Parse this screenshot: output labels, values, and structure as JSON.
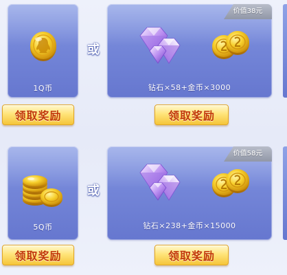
{
  "rewards": [
    {
      "qcoin_label": "1Q币",
      "or_text": "或",
      "value_badge": "价值38元",
      "bundle_label": "钻石×58+金币×3000",
      "button_left": "领取奖励",
      "button_right": "领取奖励",
      "icons": {
        "left": "single-qq-coin-icon",
        "gems": "diamond-icon",
        "coins": "gold-coin-icon"
      }
    },
    {
      "qcoin_label": "5Q币",
      "or_text": "或",
      "value_badge": "价值58元",
      "bundle_label": "钻石×238+金币×15000",
      "button_left": "领取奖励",
      "button_right": "领取奖励",
      "icons": {
        "left": "stacked-qq-coins-icon",
        "gems": "diamond-icon",
        "coins": "gold-coin-icon"
      }
    }
  ],
  "colors": {
    "panel": "#7486d8",
    "button_text": "#c2390b",
    "button_fill": "#ffe47a",
    "badge": "#9197a7"
  }
}
